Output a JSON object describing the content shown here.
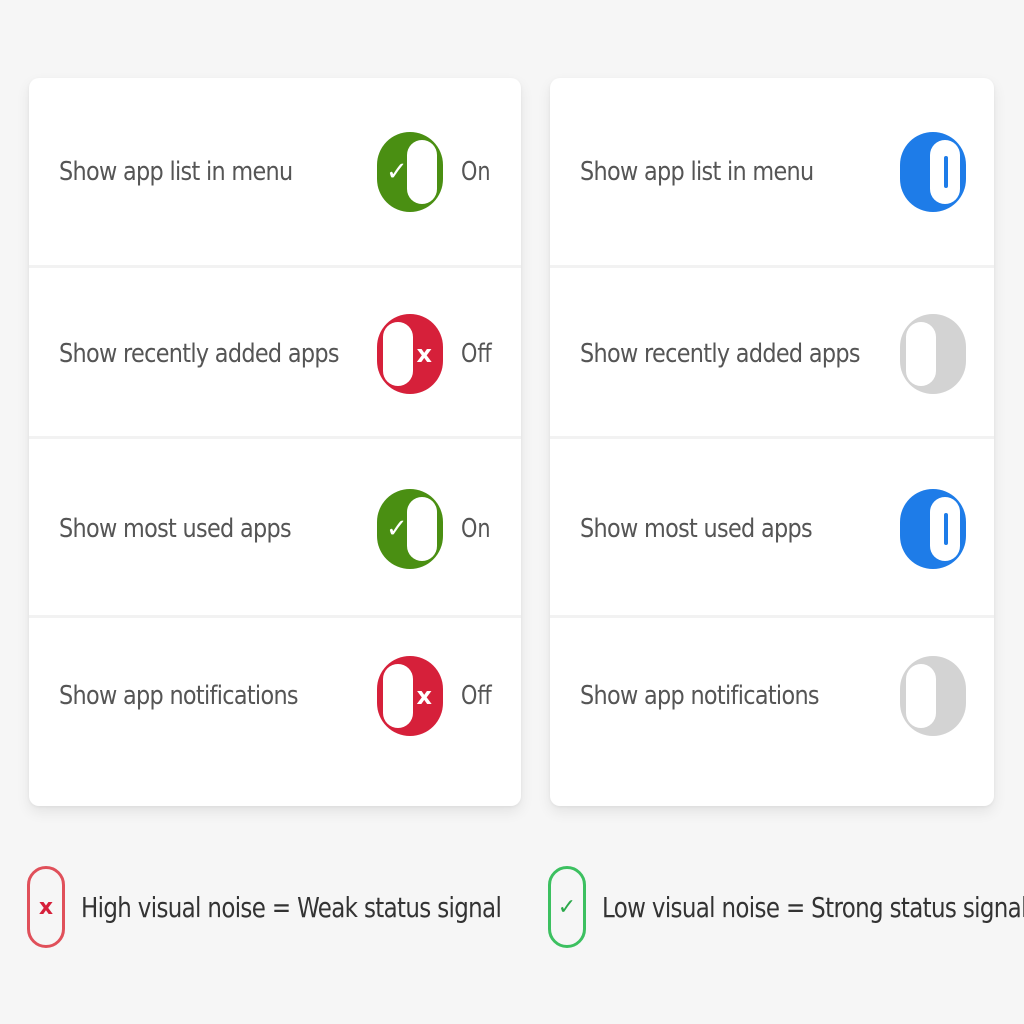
{
  "left_panel": {
    "rows": [
      {
        "label": "Show app list in menu",
        "state": "On",
        "glyph": "✓"
      },
      {
        "label": "Show recently added apps",
        "state": "Off",
        "glyph": "x"
      },
      {
        "label": "Show most used apps",
        "state": "On",
        "glyph": "✓"
      },
      {
        "label": "Show app notifications",
        "state": "Off",
        "glyph": "x"
      }
    ],
    "caption": "High visual noise = Weak status signal",
    "caption_glyph": "x"
  },
  "right_panel": {
    "rows": [
      {
        "label": "Show app list in menu",
        "on": true
      },
      {
        "label": "Show recently added apps",
        "on": false
      },
      {
        "label": "Show most used apps",
        "on": true
      },
      {
        "label": "Show app notifications",
        "on": false
      }
    ],
    "caption": "Low visual noise = Strong status signal",
    "caption_glyph": "✓"
  },
  "colors": {
    "on_green": "#4a8f12",
    "off_red": "#d6203a",
    "on_blue": "#1e7ce8",
    "off_grey": "#d3d3d3",
    "bad_badge": "#e0505a",
    "good_badge": "#3cc060"
  }
}
